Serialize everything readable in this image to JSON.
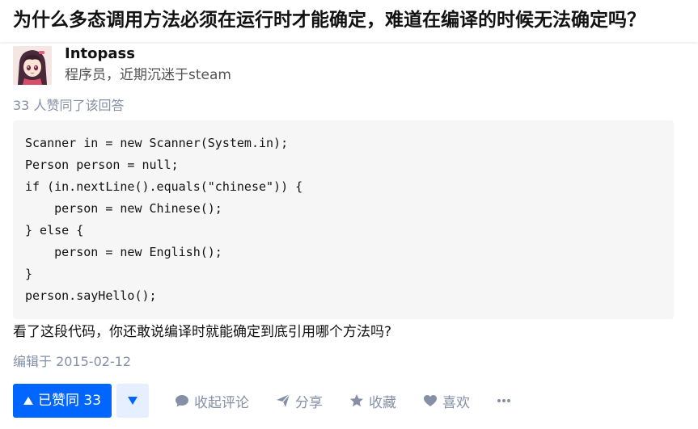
{
  "question": {
    "title": "为什么多态调用方法必须在运行时才能确定，难道在编译的时候无法确定吗？"
  },
  "author": {
    "name": "Intopass",
    "headline": "程序员，近期沉迷于steam"
  },
  "answer": {
    "vote_meta": "33 人赞同了该回答",
    "code_lines": [
      "Scanner in = new Scanner(System.in);",
      "Person person = null;",
      "if (in.nextLine().equals(\"chinese\")) {",
      "    person = new Chinese();",
      "} else {",
      "    person = new English();",
      "}",
      "person.sayHello();"
    ],
    "text": "看了这段代码，你还敢说编译时就能确定到底引用哪个方法吗?",
    "edited_time": "编辑于 2015-02-12"
  },
  "actions": {
    "vote_up_label": "已赞同 33",
    "comments_label": "收起评论",
    "share_label": "分享",
    "favorite_label": "收藏",
    "like_label": "喜欢"
  },
  "colors": {
    "primary": "#0066ff",
    "meta_gray": "#8590a6"
  }
}
